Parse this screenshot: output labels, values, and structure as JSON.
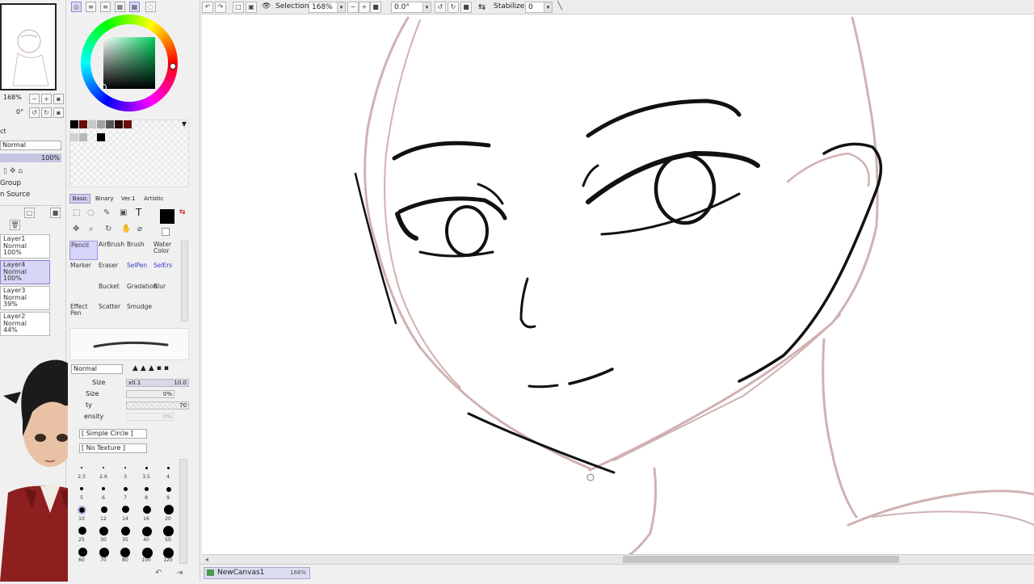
{
  "toolbar": {
    "selection_label": "Selection",
    "zoom": "168%",
    "rotation": "0.0°",
    "stabilizer_label": "Stabilizer",
    "stabilizer_value": "0"
  },
  "navigator": {
    "zoom": "168%",
    "angle": "0°"
  },
  "layer_panel": {
    "partial_label": "ct",
    "blend_mode": "Normal",
    "opacity": "100%",
    "group_label": "Group",
    "source_label": "n Source",
    "layers": [
      {
        "name": "Layer1",
        "mode": "Normal",
        "opacity": "100%",
        "selected": false
      },
      {
        "name": "Layer4",
        "mode": "Normal",
        "opacity": "100%",
        "selected": true
      },
      {
        "name": "Layer3",
        "mode": "Normal",
        "opacity": "39%",
        "selected": false
      },
      {
        "name": "Layer2",
        "mode": "Normal",
        "opacity": "44%",
        "selected": false
      }
    ]
  },
  "tool_tabs": [
    "Basic",
    "Binary",
    "Ver.1",
    "Artistic"
  ],
  "tools": [
    {
      "label": "Pencil",
      "selected": true
    },
    {
      "label": "AirBrush",
      "selected": false
    },
    {
      "label": "Brush",
      "selected": false
    },
    {
      "label": "Water Color",
      "selected": false
    },
    {
      "label": "Marker",
      "selected": false
    },
    {
      "label": "Eraser",
      "selected": false
    },
    {
      "label": "SelPen",
      "selected": false
    },
    {
      "label": "SelErs",
      "selected": false
    },
    {
      "label": "",
      "selected": false
    },
    {
      "label": "Bucket",
      "selected": false
    },
    {
      "label": "Gradation",
      "selected": false
    },
    {
      "label": "Blur",
      "selected": false
    },
    {
      "label": "Effect Pen",
      "selected": false
    },
    {
      "label": "Scatter",
      "selected": false
    },
    {
      "label": "Smudge",
      "selected": false
    }
  ],
  "brush_settings": {
    "blend_mode": "Normal",
    "size_label": "Size",
    "size_multiplier": "x0.1",
    "size_value": "10.0",
    "min_size_label": "Size",
    "min_size_value": "0%",
    "density_label": "ty",
    "density_value": "70",
    "max_density_label": "ensity",
    "max_density_value": "0%",
    "shape": "[ Simple Circle ]",
    "texture": "[ No Texture ]"
  },
  "brush_sizes_row1": [
    "2.3",
    "2.6",
    "3",
    "3.5",
    "4"
  ],
  "brush_sizes_row2": [
    "5",
    "6",
    "7",
    "8",
    "9"
  ],
  "brush_sizes_row3": [
    "10",
    "12",
    "14",
    "16",
    "20"
  ],
  "brush_sizes_row4": [
    "25",
    "30",
    "35",
    "40",
    "50"
  ],
  "brush_sizes_row5": [
    "60",
    "70",
    "80",
    "100",
    "120"
  ],
  "document_tab": {
    "name": "NewCanvas1",
    "zoom": "168%"
  }
}
